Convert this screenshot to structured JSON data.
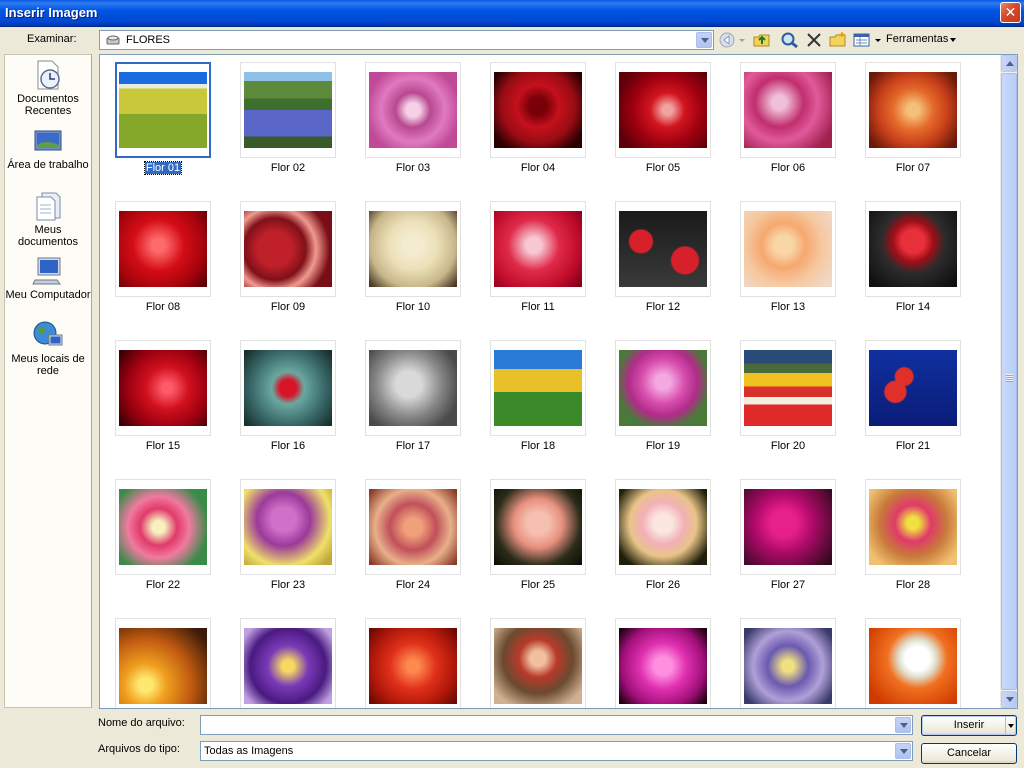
{
  "window": {
    "title": "Inserir Imagem",
    "close_label": "✕"
  },
  "look_in": {
    "label": "Examinar:",
    "value": "FLORES"
  },
  "toolbar": {
    "tools_label": "Ferramentas"
  },
  "places": [
    {
      "label": "Documentos Recentes",
      "icon": "recent-documents-icon"
    },
    {
      "label": "Área de trabalho",
      "icon": "desktop-icon"
    },
    {
      "label": "Meus documentos",
      "icon": "my-documents-icon"
    },
    {
      "label": "Meu Computador",
      "icon": "my-computer-icon"
    },
    {
      "label": "Meus locais de rede",
      "icon": "network-places-icon"
    }
  ],
  "thumbnails": [
    "Flor 01",
    "Flor 02",
    "Flor 03",
    "Flor 04",
    "Flor 05",
    "Flor 06",
    "Flor 07",
    "Flor 08",
    "Flor 09",
    "Flor 10",
    "Flor 11",
    "Flor 12",
    "Flor 13",
    "Flor 14",
    "Flor 15",
    "Flor 16",
    "Flor 17",
    "Flor 18",
    "Flor 19",
    "Flor 20",
    "Flor 21",
    "Flor 22",
    "Flor 23",
    "Flor 24",
    "Flor 25",
    "Flor 26",
    "Flor 27",
    "Flor 28",
    "",
    "",
    "",
    "",
    "",
    "",
    ""
  ],
  "selected_thumbnail": "Flor 01",
  "file_name": {
    "label": "Nome do arquivo:",
    "value": ""
  },
  "file_type": {
    "label": "Arquivos do tipo:",
    "value": "Todas as Imagens"
  },
  "buttons": {
    "insert": "Inserir",
    "cancel": "Cancelar"
  }
}
